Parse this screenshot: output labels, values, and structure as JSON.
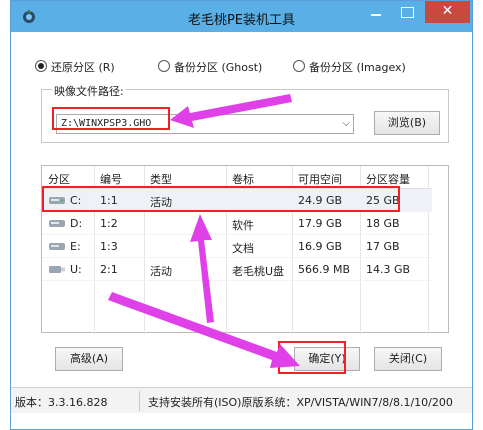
{
  "window": {
    "title": "老毛桃PE装机工具",
    "close_glyph": "✕"
  },
  "mode": {
    "options": [
      {
        "label": "还原分区 (R)",
        "checked": true
      },
      {
        "label": "备份分区 (Ghost)",
        "checked": false
      },
      {
        "label": "备份分区 (Imagex)",
        "checked": false
      }
    ]
  },
  "image": {
    "group_title": "映像文件路径:",
    "path_value": "Z:\\WINXPSP3.GHO",
    "browse_label": "浏览(B)"
  },
  "partitions": {
    "headers": [
      "分区",
      "编号",
      "类型",
      "卷标",
      "可用空间",
      "分区容量"
    ],
    "rows": [
      {
        "drive": "C:",
        "num": "1:1",
        "type": "活动",
        "label": "",
        "free": "24.9 GB",
        "size": "25 GB",
        "icon": "hard-drive-icon"
      },
      {
        "drive": "D:",
        "num": "1:2",
        "type": "",
        "label": "软件",
        "free": "17.9 GB",
        "size": "18 GB",
        "icon": "hard-drive-icon"
      },
      {
        "drive": "E:",
        "num": "1:3",
        "type": "",
        "label": "文档",
        "free": "16.9 GB",
        "size": "17 GB",
        "icon": "hard-drive-icon"
      },
      {
        "drive": "U:",
        "num": "2:1",
        "type": "活动",
        "label": "老毛桃U盘",
        "free": "566.9 MB",
        "size": "14.3 GB",
        "icon": "usb-drive-icon"
      }
    ]
  },
  "buttons": {
    "advanced": "高级(A)",
    "ok": "确定(Y)",
    "close": "关闭(C)"
  },
  "status": {
    "version": "版本：3.3.16.828",
    "support": "支持安装所有(ISO)原版系统：XP/VISTA/WIN7/8/8.1/10/200"
  },
  "colors": {
    "titlebar": "#5ab0e6",
    "close": "#c9483f",
    "highlight": "#e22222",
    "arrow": "#e040e8"
  }
}
